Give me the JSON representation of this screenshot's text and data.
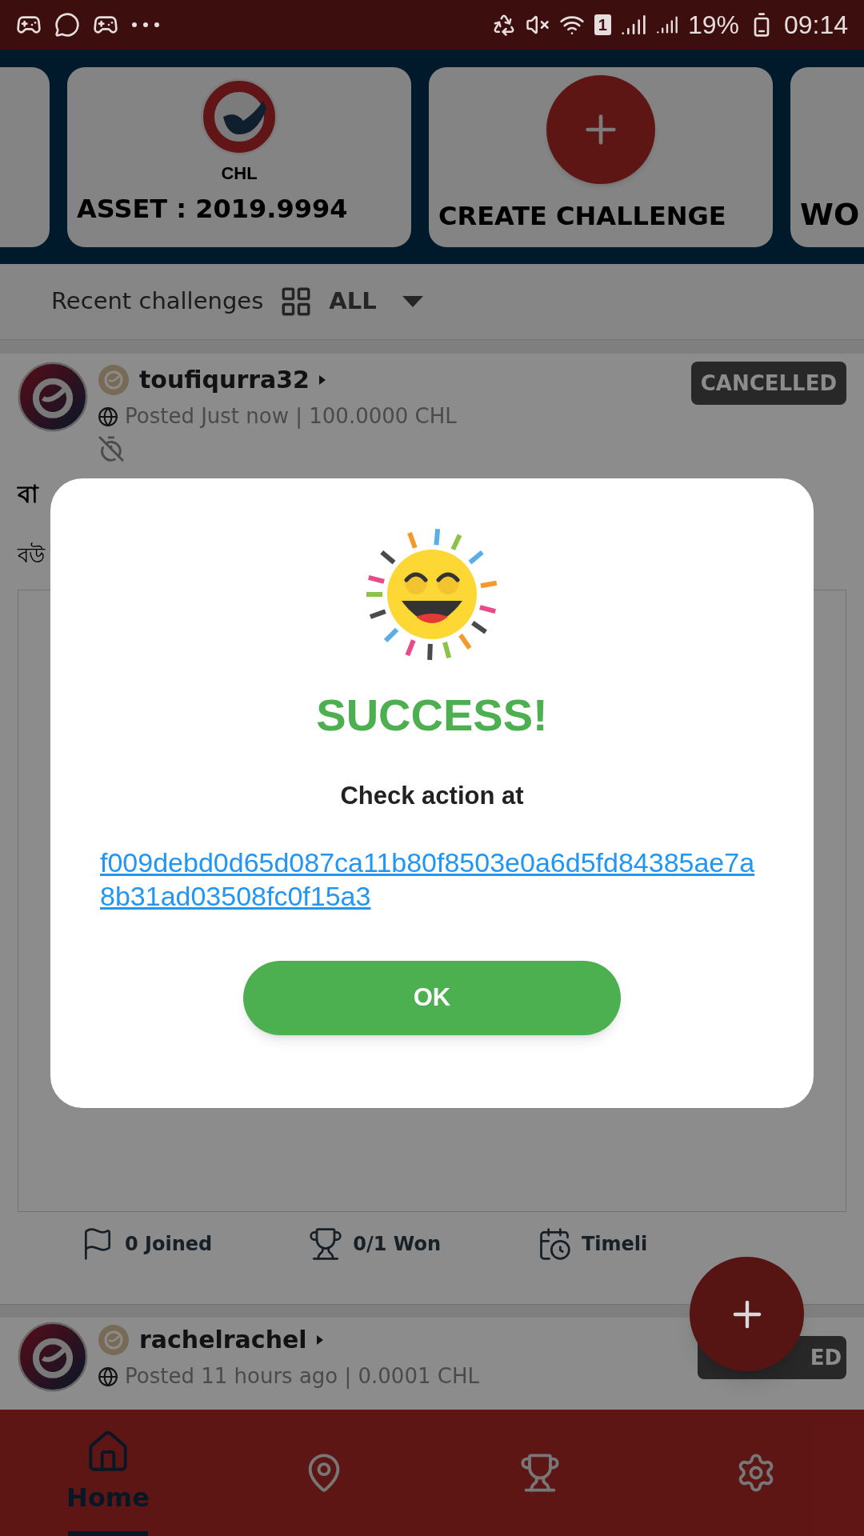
{
  "status_bar": {
    "sim": "1",
    "battery": "19%",
    "time": "09:14"
  },
  "cards": [
    {
      "kind": "partial"
    },
    {
      "kind": "asset",
      "token": "CHL",
      "label": "ASSET : 2019.9994"
    },
    {
      "kind": "create",
      "label": "CREATE CHALLENGE"
    },
    {
      "kind": "partial",
      "label": "WO"
    }
  ],
  "filter": {
    "label": "Recent challenges",
    "value": "ALL"
  },
  "posts": [
    {
      "user": "toufiqurra32",
      "meta": "Posted Just now | 100.0000 CHL",
      "status": "CANCELLED",
      "title": "বা",
      "body": "বউ",
      "stats": [
        {
          "kind": "joined",
          "label": "0 Joined"
        },
        {
          "kind": "won",
          "label": "0/1 Won"
        },
        {
          "kind": "timeline",
          "label": "Timeli"
        }
      ]
    },
    {
      "user": "rachelrachel",
      "meta": "Posted 11 hours ago | 0.0001 CHL",
      "status_parts": [
        "ED"
      ]
    }
  ],
  "dialog": {
    "title": "SUCCESS!",
    "message": "Check action at",
    "link": "f009debd0d65d087ca11b80f8503e0a6d5fd84385ae7a8b31ad03508fc0f15a3",
    "button": "OK"
  },
  "nav": [
    {
      "kind": "home",
      "label": "Home",
      "selected": true
    },
    {
      "kind": "map",
      "selected": false
    },
    {
      "kind": "trophy",
      "selected": false
    },
    {
      "kind": "settings",
      "selected": false
    }
  ]
}
